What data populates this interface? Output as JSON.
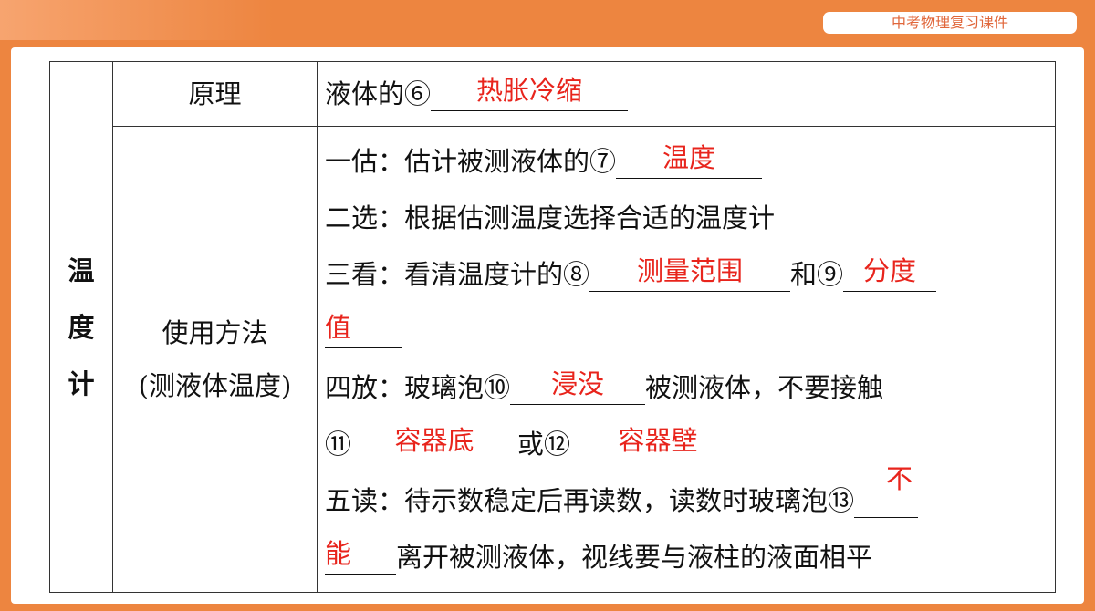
{
  "header": {
    "badge": "中考物理复习课件"
  },
  "table": {
    "category": [
      "温",
      "度",
      "计"
    ],
    "rows": [
      {
        "label": "原理",
        "text_pre": "液体的⑥",
        "answer": "热胀冷缩"
      },
      {
        "label_line1": "使用方法",
        "label_line2": "(测液体温度)",
        "steps": {
          "s1_pre": "一估：估计被测液体的⑦",
          "s1_ans": "温度",
          "s2": "二选：根据估测温度选择合适的温度计",
          "s3_pre": "三看：看清温度计的⑧",
          "s3_ans1": "测量范围",
          "s3_mid": "和⑨",
          "s3_ans2a": "分度",
          "s3_ans2b": "值",
          "s4_pre": "四放：玻璃泡⑩",
          "s4_ans": "浸没",
          "s4_post": "被测液体，不要接触",
          "s4b_pre": "⑪",
          "s4b_ans1": "容器底",
          "s4b_mid": "或⑫",
          "s4b_ans2": "容器壁",
          "s5_pre": "五读：待示数稳定后再读数，读数时玻璃泡⑬",
          "s5_ans_a": "不",
          "s5_ans_b": "能",
          "s5_post": "离开被测液体，视线要与液柱的液面相平"
        }
      }
    ]
  },
  "colors": {
    "background": "#ed8540",
    "answer": "#e8241c",
    "badge_text": "#e0663a"
  }
}
